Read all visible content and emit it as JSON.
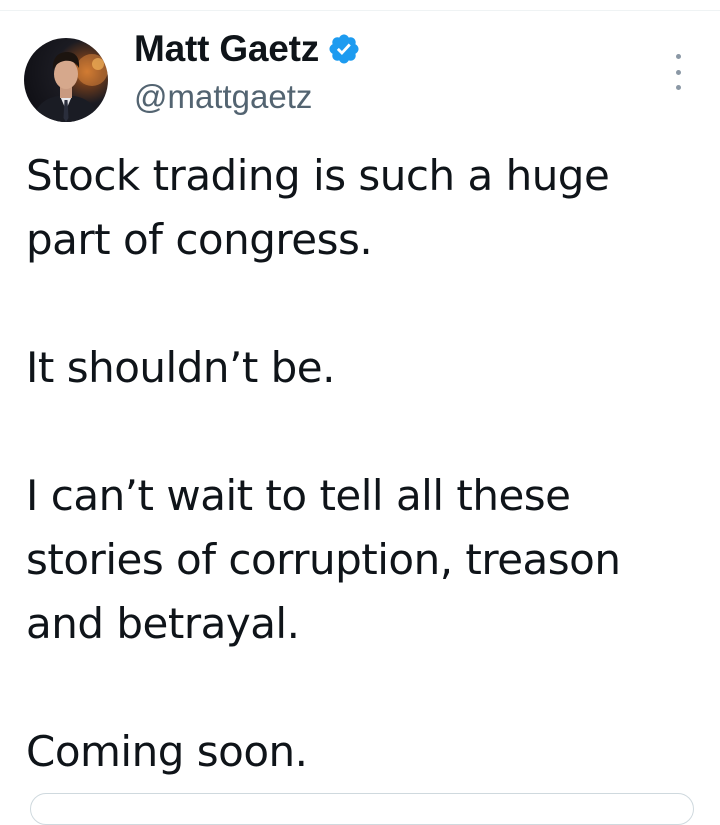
{
  "tweet": {
    "author": {
      "display_name": "Matt Gaetz",
      "handle": "@mattgaetz",
      "verified": true,
      "verified_badge_color": "#1d9bf0",
      "avatar_icon": "profile-photo"
    },
    "more_icon": "more-vertical-icon",
    "paragraphs": [
      "Stock trading is such a huge part of congress.",
      "It shouldn’t be.",
      "I can’t wait to tell all these stories of corruption, treason and betrayal.",
      "Coming soon."
    ]
  },
  "colors": {
    "text_primary": "#0f1419",
    "text_secondary": "#536471",
    "accent": "#1d9bf0",
    "divider": "#eff3f4"
  }
}
